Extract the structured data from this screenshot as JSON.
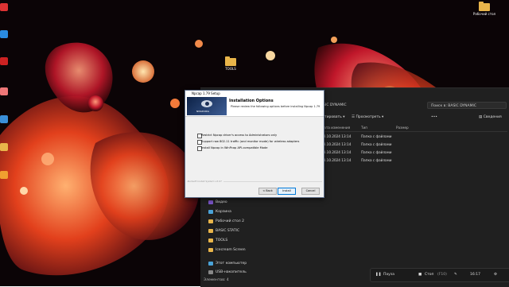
{
  "desktop": {
    "right_icon_label": "Рабочий стол",
    "center_icon_label": "TOOLS"
  },
  "installer": {
    "title": "Npcap 1.79 Setup",
    "banner_heading": "Installation Options",
    "banner_sub": "Please review the following options before installing Npcap 1.79",
    "logo_text": "NMAP.ORG",
    "options": [
      {
        "label": "Restrict Npcap driver's access to Administrators only",
        "checked": false
      },
      {
        "label": "Support raw 802.11 traffic (and monitor mode) for wireless adapters",
        "checked": false
      },
      {
        "label": "Install Npcap in WinPcap API-compatible Mode",
        "checked": false
      }
    ],
    "footer": "Nullsoft Install System v3.07",
    "back": "< Back",
    "install": "Install",
    "cancel": "Cancel"
  },
  "explorer": {
    "address": "BASIC DYNAMIC",
    "search_placeholder": "Поиск в: BASIC DYNAMIC",
    "toolbar": {
      "sort": "Сортировать",
      "view": "Просмотреть",
      "details": "Сведения"
    },
    "columns": [
      "Дата изменения",
      "Тип",
      "Размер"
    ],
    "rows": [
      {
        "date": "28.10.2024 13:14",
        "type": "Папка с файлами"
      },
      {
        "date": "28.10.2024 13:14",
        "type": "Папка с файлами"
      },
      {
        "date": "28.10.2024 13:14",
        "type": "Папка с файлами"
      },
      {
        "date": "28.10.2024 13:14",
        "type": "Папка с файлами"
      }
    ],
    "nav": [
      {
        "label": "Видео",
        "color": "#7a54c7"
      },
      {
        "label": "Корзина",
        "color": "#4aa3d8"
      },
      {
        "label": "Рабочий стол 2",
        "color": "#e9b54a"
      },
      {
        "label": "BASIC STATIC",
        "color": "#e9b54a"
      },
      {
        "label": "TOOLS",
        "color": "#e9b54a"
      },
      {
        "label": "Icecream Screen",
        "color": "#e9b54a"
      },
      {
        "label": "Этот компьютер",
        "color": "#4aa3d8"
      },
      {
        "label": "USB-накопитель",
        "color": "#888888"
      }
    ],
    "status": "Элементов: 4"
  },
  "media": {
    "pause": "Пауза",
    "stop": "Стоп",
    "stop_key": "(F10)",
    "time": "16:17"
  }
}
